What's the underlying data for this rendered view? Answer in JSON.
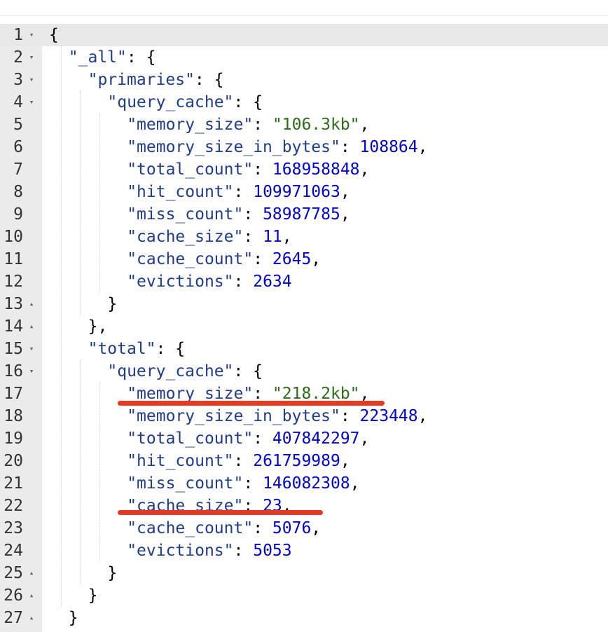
{
  "editor": {
    "lines": [
      {
        "n": "1",
        "indent": 0,
        "fold": "▾",
        "parts": [
          {
            "t": "{",
            "c": "p"
          }
        ]
      },
      {
        "n": "2",
        "indent": 1,
        "fold": "▾",
        "parts": [
          {
            "t": "\"_all\"",
            "c": "k"
          },
          {
            "t": ": {",
            "c": "p"
          }
        ]
      },
      {
        "n": "3",
        "indent": 2,
        "fold": "▾",
        "parts": [
          {
            "t": "\"primaries\"",
            "c": "k"
          },
          {
            "t": ": {",
            "c": "p"
          }
        ]
      },
      {
        "n": "4",
        "indent": 3,
        "fold": "▾",
        "parts": [
          {
            "t": "\"query_cache\"",
            "c": "k"
          },
          {
            "t": ": {",
            "c": "p"
          }
        ]
      },
      {
        "n": "5",
        "indent": 4,
        "fold": "",
        "parts": [
          {
            "t": "\"memory_size\"",
            "c": "k"
          },
          {
            "t": ": ",
            "c": "p"
          },
          {
            "t": "\"106.3kb\"",
            "c": "s"
          },
          {
            "t": ",",
            "c": "p"
          }
        ]
      },
      {
        "n": "6",
        "indent": 4,
        "fold": "",
        "parts": [
          {
            "t": "\"memory_size_in_bytes\"",
            "c": "k"
          },
          {
            "t": ": ",
            "c": "p"
          },
          {
            "t": "108864",
            "c": "n"
          },
          {
            "t": ",",
            "c": "p"
          }
        ]
      },
      {
        "n": "7",
        "indent": 4,
        "fold": "",
        "parts": [
          {
            "t": "\"total_count\"",
            "c": "k"
          },
          {
            "t": ": ",
            "c": "p"
          },
          {
            "t": "168958848",
            "c": "n"
          },
          {
            "t": ",",
            "c": "p"
          }
        ]
      },
      {
        "n": "8",
        "indent": 4,
        "fold": "",
        "parts": [
          {
            "t": "\"hit_count\"",
            "c": "k"
          },
          {
            "t": ": ",
            "c": "p"
          },
          {
            "t": "109971063",
            "c": "n"
          },
          {
            "t": ",",
            "c": "p"
          }
        ]
      },
      {
        "n": "9",
        "indent": 4,
        "fold": "",
        "parts": [
          {
            "t": "\"miss_count\"",
            "c": "k"
          },
          {
            "t": ": ",
            "c": "p"
          },
          {
            "t": "58987785",
            "c": "n"
          },
          {
            "t": ",",
            "c": "p"
          }
        ]
      },
      {
        "n": "10",
        "indent": 4,
        "fold": "",
        "parts": [
          {
            "t": "\"cache_size\"",
            "c": "k"
          },
          {
            "t": ": ",
            "c": "p"
          },
          {
            "t": "11",
            "c": "n"
          },
          {
            "t": ",",
            "c": "p"
          }
        ]
      },
      {
        "n": "11",
        "indent": 4,
        "fold": "",
        "parts": [
          {
            "t": "\"cache_count\"",
            "c": "k"
          },
          {
            "t": ": ",
            "c": "p"
          },
          {
            "t": "2645",
            "c": "n"
          },
          {
            "t": ",",
            "c": "p"
          }
        ]
      },
      {
        "n": "12",
        "indent": 4,
        "fold": "",
        "parts": [
          {
            "t": "\"evictions\"",
            "c": "k"
          },
          {
            "t": ": ",
            "c": "p"
          },
          {
            "t": "2634",
            "c": "n"
          }
        ]
      },
      {
        "n": "13",
        "indent": 3,
        "fold": "▴",
        "parts": [
          {
            "t": "}",
            "c": "p"
          }
        ]
      },
      {
        "n": "14",
        "indent": 2,
        "fold": "▴",
        "parts": [
          {
            "t": "},",
            "c": "p"
          }
        ]
      },
      {
        "n": "15",
        "indent": 2,
        "fold": "▾",
        "parts": [
          {
            "t": "\"total\"",
            "c": "k"
          },
          {
            "t": ": {",
            "c": "p"
          }
        ]
      },
      {
        "n": "16",
        "indent": 3,
        "fold": "▾",
        "parts": [
          {
            "t": "\"query_cache\"",
            "c": "k"
          },
          {
            "t": ": {",
            "c": "p"
          }
        ]
      },
      {
        "n": "17",
        "indent": 4,
        "fold": "",
        "parts": [
          {
            "t": "\"memory_size\"",
            "c": "k"
          },
          {
            "t": ": ",
            "c": "p"
          },
          {
            "t": "\"218.2kb\"",
            "c": "s"
          },
          {
            "t": ",",
            "c": "p"
          }
        ]
      },
      {
        "n": "18",
        "indent": 4,
        "fold": "",
        "parts": [
          {
            "t": "\"memory_size_in_bytes\"",
            "c": "k"
          },
          {
            "t": ": ",
            "c": "p"
          },
          {
            "t": "223448",
            "c": "n"
          },
          {
            "t": ",",
            "c": "p"
          }
        ]
      },
      {
        "n": "19",
        "indent": 4,
        "fold": "",
        "parts": [
          {
            "t": "\"total_count\"",
            "c": "k"
          },
          {
            "t": ": ",
            "c": "p"
          },
          {
            "t": "407842297",
            "c": "n"
          },
          {
            "t": ",",
            "c": "p"
          }
        ]
      },
      {
        "n": "20",
        "indent": 4,
        "fold": "",
        "parts": [
          {
            "t": "\"hit_count\"",
            "c": "k"
          },
          {
            "t": ": ",
            "c": "p"
          },
          {
            "t": "261759989",
            "c": "n"
          },
          {
            "t": ",",
            "c": "p"
          }
        ]
      },
      {
        "n": "21",
        "indent": 4,
        "fold": "",
        "parts": [
          {
            "t": "\"miss_count\"",
            "c": "k"
          },
          {
            "t": ": ",
            "c": "p"
          },
          {
            "t": "146082308",
            "c": "n"
          },
          {
            "t": ",",
            "c": "p"
          }
        ]
      },
      {
        "n": "22",
        "indent": 4,
        "fold": "",
        "parts": [
          {
            "t": "\"cache_size\"",
            "c": "k"
          },
          {
            "t": ": ",
            "c": "p"
          },
          {
            "t": "23",
            "c": "n"
          },
          {
            "t": ",",
            "c": "p"
          }
        ]
      },
      {
        "n": "23",
        "indent": 4,
        "fold": "",
        "parts": [
          {
            "t": "\"cache_count\"",
            "c": "k"
          },
          {
            "t": ": ",
            "c": "p"
          },
          {
            "t": "5076",
            "c": "n"
          },
          {
            "t": ",",
            "c": "p"
          }
        ]
      },
      {
        "n": "24",
        "indent": 4,
        "fold": "",
        "parts": [
          {
            "t": "\"evictions\"",
            "c": "k"
          },
          {
            "t": ": ",
            "c": "p"
          },
          {
            "t": "5053",
            "c": "n"
          }
        ]
      },
      {
        "n": "25",
        "indent": 3,
        "fold": "▴",
        "parts": [
          {
            "t": "}",
            "c": "p"
          }
        ]
      },
      {
        "n": "26",
        "indent": 2,
        "fold": "▴",
        "parts": [
          {
            "t": "}",
            "c": "p"
          }
        ]
      },
      {
        "n": "27",
        "indent": 1,
        "fold": "▴",
        "parts": [
          {
            "t": "}",
            "c": "p"
          }
        ]
      }
    ],
    "active_line": "1",
    "annotations": [
      {
        "name": "highlight-underline-memory-size",
        "line": "17",
        "color": "#e53a23"
      },
      {
        "name": "highlight-underline-cache-size",
        "line": "22",
        "color": "#e53a23"
      }
    ],
    "colors": {
      "key": "#1f3b8a",
      "string": "#2e6b17",
      "number": "#0000cd",
      "gutter": "#ebebeb"
    }
  }
}
